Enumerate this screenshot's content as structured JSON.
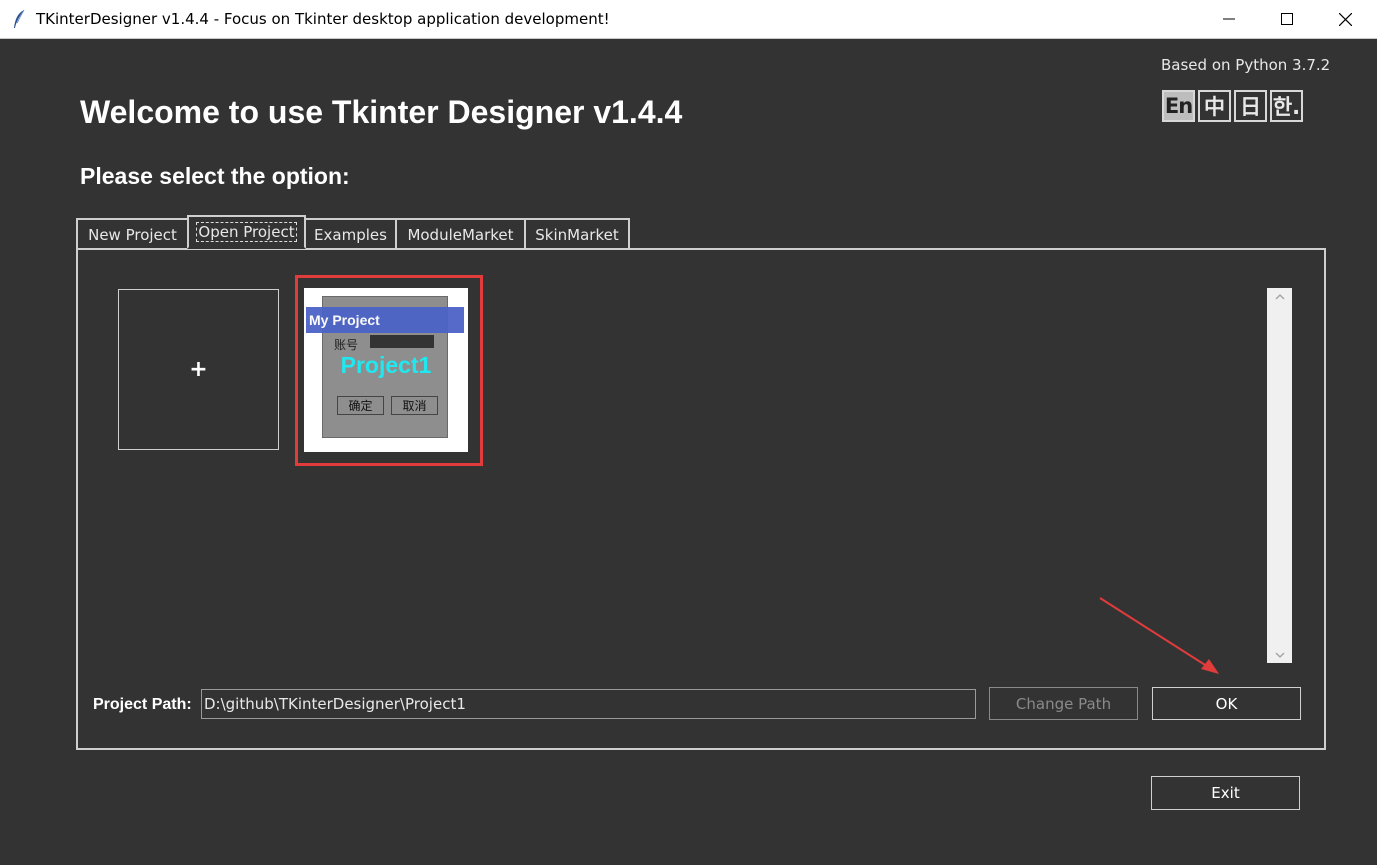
{
  "window": {
    "title": "TKinterDesigner v1.4.4 - Focus on Tkinter desktop application development!",
    "min_icon": "minimize-icon",
    "max_icon": "maximize-icon",
    "close_icon": "close-icon"
  },
  "header": {
    "python_version": "Based on Python 3.7.2",
    "welcome": "Welcome to use Tkinter Designer v1.4.4",
    "select_label": "Please select the option:"
  },
  "languages": [
    {
      "label": "En",
      "active": true
    },
    {
      "label": "中",
      "active": false
    },
    {
      "label": "日",
      "active": false
    },
    {
      "label": "한.",
      "active": false
    }
  ],
  "tabs": [
    {
      "label": "New Project",
      "active": false
    },
    {
      "label": "Open Project",
      "active": true
    },
    {
      "label": "Examples",
      "active": false
    },
    {
      "label": "ModuleMarket",
      "active": false
    },
    {
      "label": "SkinMarket",
      "active": false
    }
  ],
  "project_grid": {
    "new_tile_label": "+",
    "projects": [
      {
        "window_title": "My Project",
        "account_label": "账号",
        "name": "Project1",
        "ok_label": "确定",
        "cancel_label": "取消",
        "highlighted": true
      }
    ]
  },
  "footer": {
    "path_label": "Project Path:",
    "path_value": "D:\\github\\TKinterDesigner\\Project1",
    "change_path_label": "Change Path",
    "ok_label": "OK",
    "exit_label": "Exit"
  },
  "colors": {
    "background": "#333333",
    "highlight": "#e03c3c",
    "project_name": "#20e8f0",
    "mock_titlebar": "#4c63c7"
  }
}
